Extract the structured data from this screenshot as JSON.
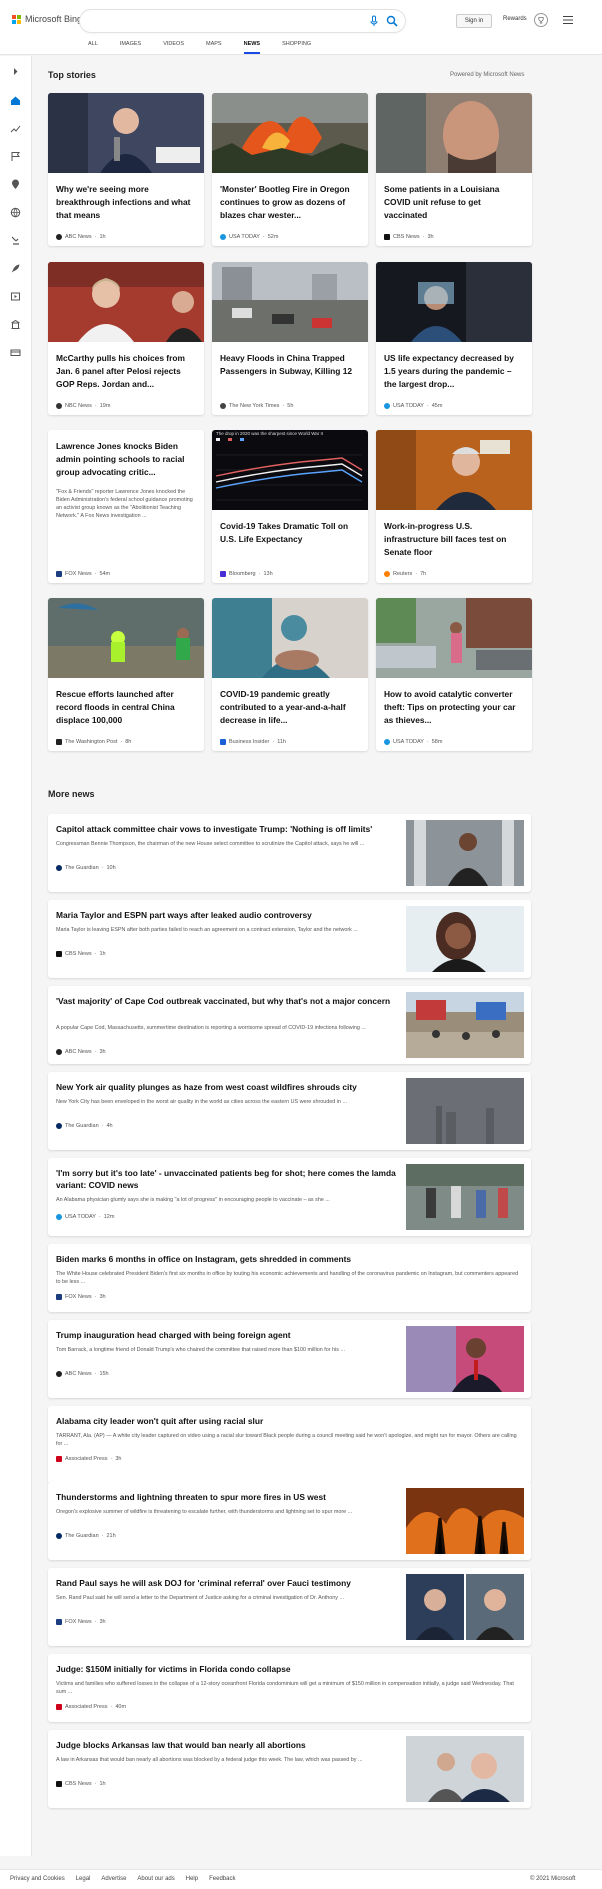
{
  "header": {
    "logo_text": "Microsoft Bing",
    "search_value": "",
    "signin_label": "Sign in",
    "rewards_label": "Rewards"
  },
  "nav": [
    "ALL",
    "IMAGES",
    "VIDEOS",
    "MAPS",
    "NEWS",
    "SHOPPING"
  ],
  "top_stories": {
    "title": "Top stories",
    "powered": "Powered by Microsoft News",
    "cards": [
      {
        "title": "Why we're seeing more breakthrough infections and what that means",
        "source": "ABC News",
        "time": "1h"
      },
      {
        "title": "'Monster' Bootleg Fire in Oregon continues to grow as dozens of blazes char wester...",
        "source": "USA TODAY",
        "time": "52m"
      },
      {
        "title": "Some patients in a Louisiana COVID unit refuse to get vaccinated",
        "source": "CBS News",
        "time": "3h"
      },
      {
        "title": "McCarthy pulls his choices from Jan. 6 panel after Pelosi rejects GOP Reps. Jordan and...",
        "source": "NBC News",
        "time": "19m"
      },
      {
        "title": "Heavy Floods in China Trapped Passengers in Subway, Killing 12",
        "source": "The New York Times",
        "time": "5h"
      },
      {
        "title": "US life expectancy decreased by 1.5 years during the pandemic – the largest drop...",
        "source": "USA TODAY",
        "time": "45m"
      },
      {
        "title": "Lawrence Jones knocks Biden admin pointing schools to racial group advocating critic...",
        "snippet": "\"Fox & Friends\" reporter Lawrence Jones knocked the Biden Administration's federal school guidance promoting an activist group known as the \"Abolitionist Teaching Network.\" A Fox News investigation ...",
        "source": "FOX News",
        "time": "54m"
      },
      {
        "title": "Covid-19 Takes Dramatic Toll on U.S. Life Expectancy",
        "source": "Bloomberg",
        "time": "13h",
        "chart_caption": "The drop in 2020 was the sharpest since World War II"
      },
      {
        "title": "Work-in-progress U.S. infrastructure bill faces test on Senate floor",
        "source": "Reuters",
        "time": "7h"
      },
      {
        "title": "Rescue efforts launched after record floods in central China displace 100,000",
        "source": "The Washington Post",
        "time": "8h"
      },
      {
        "title": "COVID-19 pandemic greatly contributed to a year-and-a-half decrease in life...",
        "source": "Business Insider",
        "time": "11h"
      },
      {
        "title": "How to avoid catalytic converter theft: Tips on protecting your car as thieves...",
        "source": "USA TODAY",
        "time": "58m"
      }
    ]
  },
  "more_news": {
    "title": "More news",
    "items": [
      {
        "title": "Capitol attack committee chair vows to investigate Trump: 'Nothing is off limits'",
        "snippet": "Congressman Bennie Thompson, the chairman of the new House select committee to scrutinize the Capitol attack, says he will ...",
        "source": "The Guardian",
        "time": "10h"
      },
      {
        "title": "Maria Taylor and ESPN part ways after leaked audio controversy",
        "snippet": "Maria Taylor is leaving ESPN after both parties failed to reach an agreement on a contract extension, Taylor and the network ...",
        "source": "CBS News",
        "time": "1h"
      },
      {
        "title": "'Vast majority' of Cape Cod outbreak vaccinated, but why that's not a major concern",
        "snippet": "A popular Cape Cod, Massachusetts, summertime destination is reporting a worrisome spread of COVID-19 infections following ...",
        "source": "ABC News",
        "time": "3h"
      },
      {
        "title": "New York air quality plunges as haze from west coast wildfires shrouds city",
        "snippet": "New York City has been enveloped in the worst air quality in the world as cities across the eastern US were shrouded in ...",
        "source": "The Guardian",
        "time": "4h"
      },
      {
        "title": "'I'm sorry but it's too late' - unvaccinated patients beg for shot; here comes the lamda variant: COVID news",
        "snippet": "An Alabama physician glumly says she is making \"a lot of progress\" in encouraging people to vaccinate – as she ...",
        "source": "USA TODAY",
        "time": "12m"
      },
      {
        "title": "Biden marks 6 months in office on Instagram, gets shredded in comments",
        "snippet": "The White House celebrated President Biden's first six months in office by touting his economic achievements and handling of the coronavirus pandemic on Instagram, but commenters appeared to be less ...",
        "source": "FOX News",
        "time": "3h"
      },
      {
        "title": "Trump inauguration head charged with being foreign agent",
        "snippet": "Tom Barrack, a longtime friend of Donald Trump's who chaired the committee that raised more than $100 million for his ...",
        "source": "ABC News",
        "time": "15h"
      },
      {
        "title": "Alabama city leader won't quit after using racial slur",
        "snippet": "TARRANT, Ala. (AP) — A white city leader captured on video using a racial slur toward Black people during a council meeting said he won't apologize, and might run for mayor. Others are calling for ...",
        "source": "Associated Press",
        "time": "3h"
      },
      {
        "title": "Thunderstorms and lightning threaten to spur more fires in US west",
        "snippet": "Oregon's explosive summer of wildfire is threatening to escalate further, with thunderstorms and lightning set to spur more ...",
        "source": "The Guardian",
        "time": "21h"
      },
      {
        "title": "Rand Paul says he will ask DOJ for 'criminal referral' over Fauci testimony",
        "snippet": "Sen. Rand Paul said he will send a letter to the Department of Justice asking for a criminal investigation of Dr. Anthony ...",
        "source": "FOX News",
        "time": "3h"
      },
      {
        "title": "Judge: $150M initially for victims in Florida condo collapse",
        "snippet": "Victims and families who suffered losses in the collapse of a 12-story oceanfront Florida condominium will get a minimum of $150 million in compensation initially, a judge said Wednesday. That sum ...",
        "source": "Associated Press",
        "time": "40m"
      },
      {
        "title": "Judge blocks Arkansas law that would ban nearly all abortions",
        "snippet": "A law in Arkansas that would ban nearly all abortions was blocked by a federal judge this week. The law, which was passed by ...",
        "source": "CBS News",
        "time": "1h"
      }
    ]
  },
  "footer": {
    "links": [
      "Privacy and Cookies",
      "Legal",
      "Advertise",
      "About our ads",
      "Help",
      "Feedback"
    ],
    "copyright": "© 2021 Microsoft"
  },
  "colors": {
    "accent": "#174ae4",
    "bing_blue": "#0078d4"
  }
}
